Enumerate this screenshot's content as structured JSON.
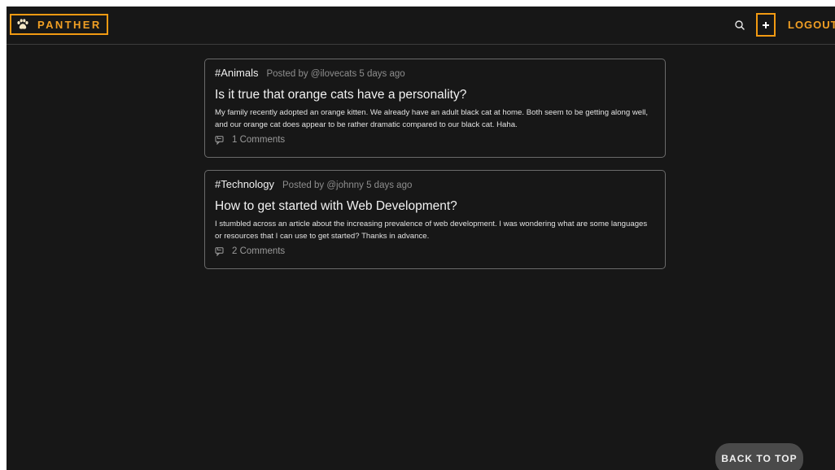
{
  "navbar": {
    "brand_name": "PANTHER",
    "brand_icon": "paw-icon",
    "search_icon": "search-icon",
    "new_post_icon": "plus-icon",
    "logout_label": "LOGOUT"
  },
  "posts": [
    {
      "category": "#Animals",
      "posted_by": "Posted by @ilovecats 5 days ago",
      "title": "Is it true that orange cats have a personality?",
      "body": "My family recently adopted an orange kitten. We already have an adult black cat at home. Both seem to be getting along well, and our orange cat does appear to be rather dramatic compared to our black cat. Haha.",
      "comments": "1 Comments"
    },
    {
      "category": "#Technology",
      "posted_by": "Posted by @johnny 5 days ago",
      "title": "How to get started with Web Development?",
      "body": "I stumbled across an article about the increasing prevalence of web development. I was wondering what are some languages or resources that I can use to get started? Thanks in advance.",
      "comments": "2 Comments"
    }
  ],
  "back_to_top_label": "BACK TO TOP",
  "colors": {
    "background": "#171717",
    "accent": "#f29a12",
    "card_border": "#6a6a6a",
    "back_to_top_bg": "#4a4a4a"
  }
}
